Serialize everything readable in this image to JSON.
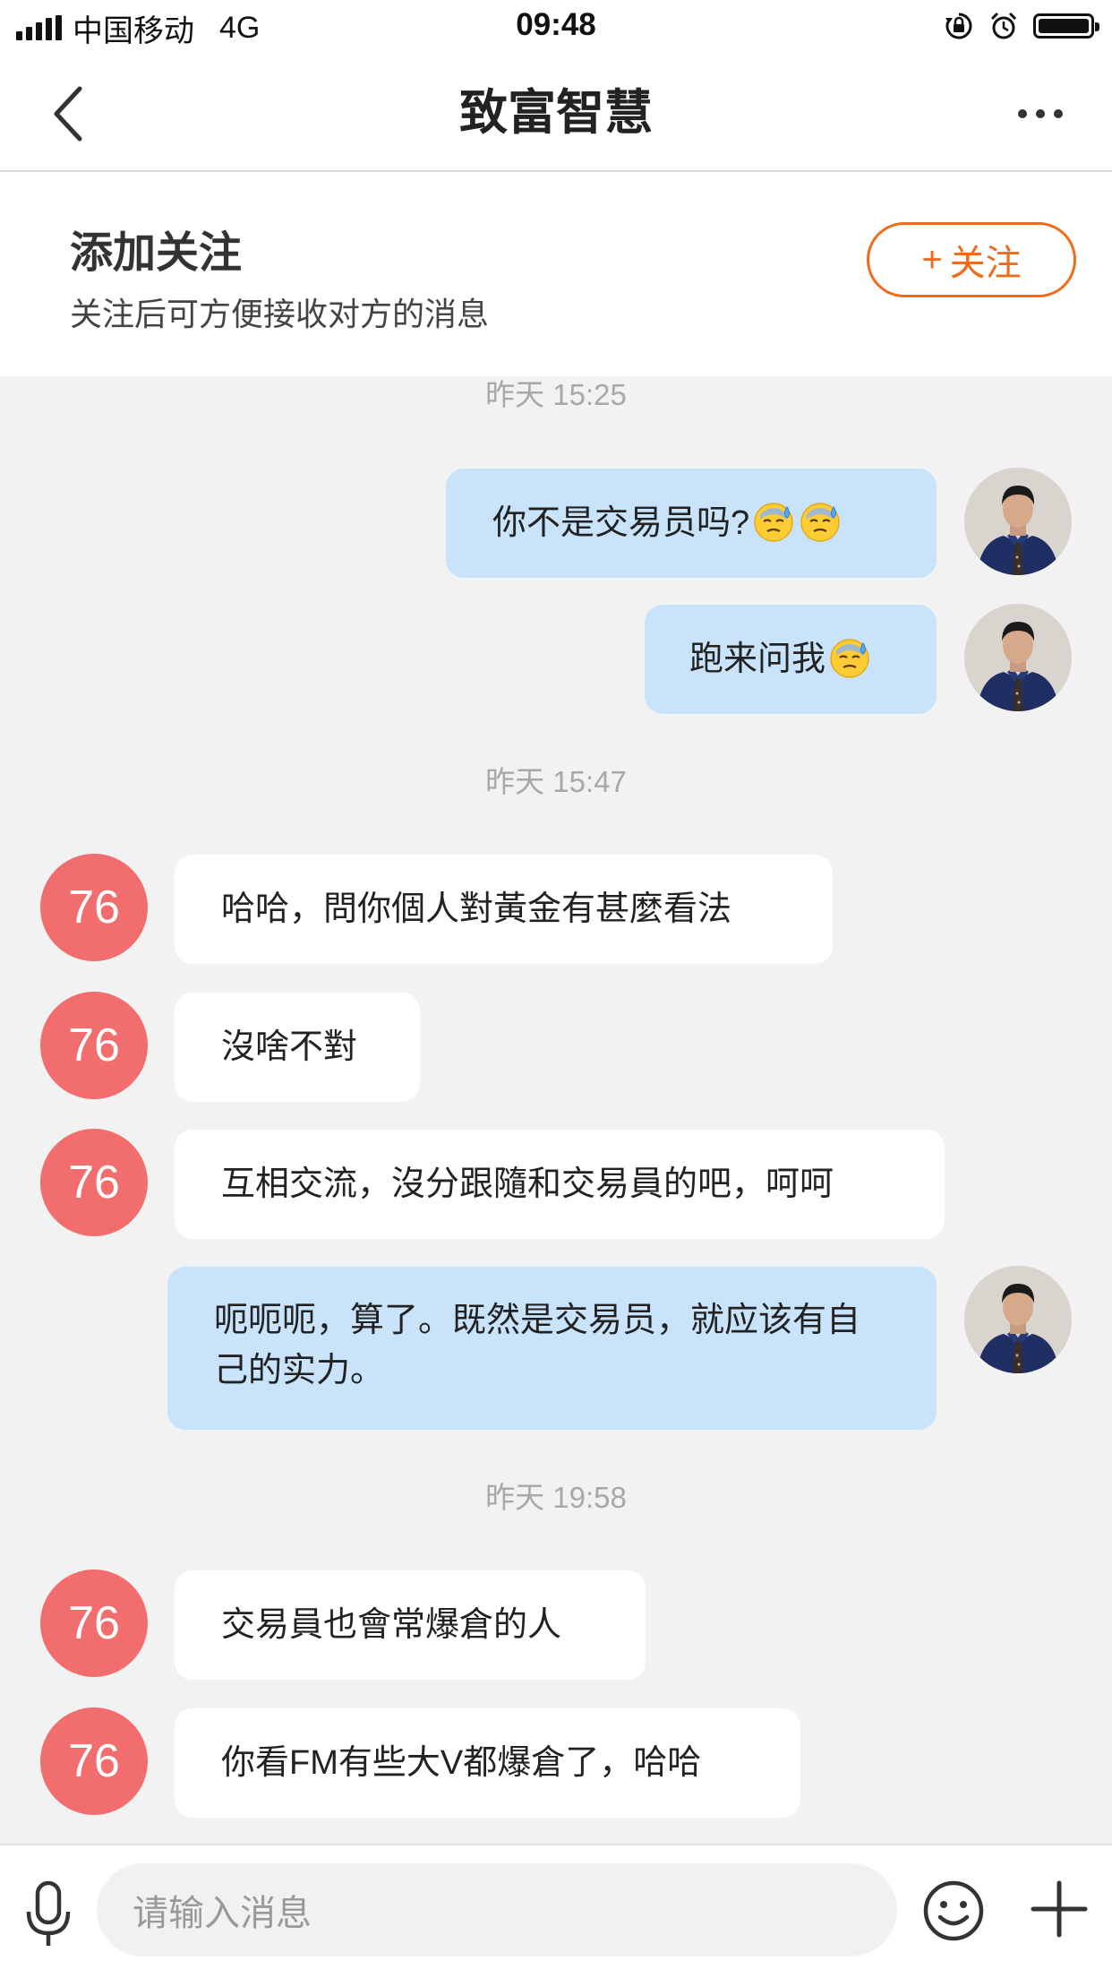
{
  "status_bar": {
    "carrier": "中国移动",
    "network": "4G",
    "time": "09:48"
  },
  "nav": {
    "title": "致富智慧"
  },
  "follow_banner": {
    "title": "添加关注",
    "subtitle": "关注后可方便接收对方的消息",
    "button_plus": "+",
    "button_label": "关注"
  },
  "chat": {
    "timestamps": [
      "昨天 15:25",
      "昨天 15:47",
      "昨天 19:58"
    ],
    "peer_avatar_text": "76",
    "messages": [
      {
        "text": "你不是交易员吗?"
      },
      {
        "text": "跑来问我"
      },
      {
        "text": "哈哈，問你個人對黃金有甚麼看法"
      },
      {
        "text": "沒啥不對"
      },
      {
        "text": "互相交流，沒分跟隨和交易員的吧，呵呵"
      },
      {
        "text": "呃呃呃，算了。既然是交易员，就应该有自己的实力。"
      },
      {
        "text": "交易員也會常爆倉的人"
      },
      {
        "text": "你看FM有些大V都爆倉了，哈哈"
      }
    ]
  },
  "input_bar": {
    "placeholder": "请输入消息"
  },
  "colors": {
    "accent": "#f26b1d",
    "peer_avatar": "#f26d6d",
    "my_bubble": "#c9e3fb"
  },
  "icons": {
    "back": "chevron-left-icon",
    "more": "more-dots-icon",
    "mic": "microphone-icon",
    "emoji": "smiley-icon",
    "plus": "plus-icon",
    "sweat": "sweat-emoji"
  }
}
